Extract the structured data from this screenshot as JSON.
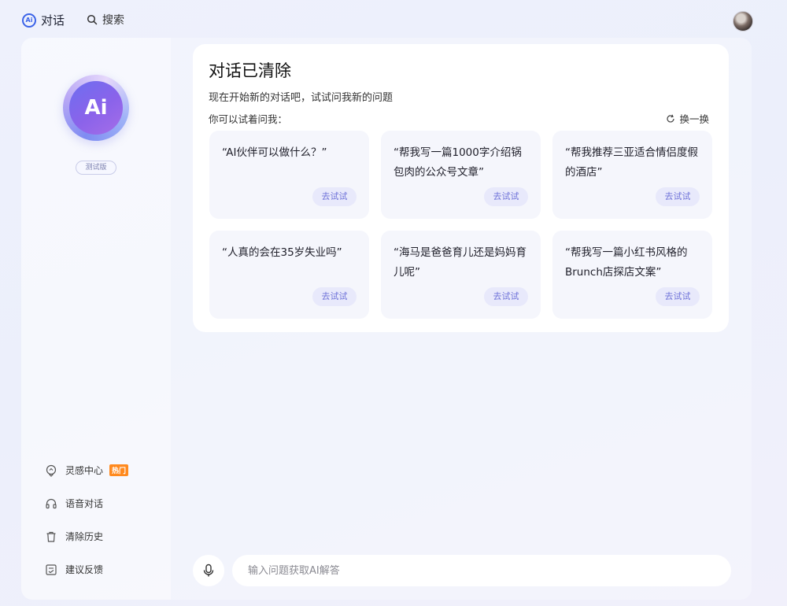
{
  "topbar": {
    "chat_label": "对话",
    "chat_icon_text": "Ai",
    "search_label": "搜索"
  },
  "sidebar": {
    "logo_text": "Ai",
    "beta_label": "测试版",
    "items": [
      {
        "label": "灵感中心",
        "icon": "lightbulb-icon",
        "badge": "热门"
      },
      {
        "label": "语音对话",
        "icon": "headset-icon"
      },
      {
        "label": "清除历史",
        "icon": "trash-icon"
      },
      {
        "label": "建议反馈",
        "icon": "feedback-icon"
      }
    ]
  },
  "main": {
    "title": "对话已清除",
    "subtitle": "现在开始新的对话吧，试试问我新的问题",
    "ask_hint": "你可以试着问我：",
    "refresh_label": "换一换",
    "try_label": "去试试",
    "suggestions": [
      {
        "text": "“AI伙伴可以做什么？”"
      },
      {
        "text": "“帮我写一篇1000字介绍锅包肉的公众号文章”"
      },
      {
        "text": "“帮我推荐三亚适合情侣度假的酒店”"
      },
      {
        "text": "“人真的会在35岁失业吗”"
      },
      {
        "text": "“海马是爸爸育儿还是妈妈育儿呢”"
      },
      {
        "text": "“帮我写一篇小红书风格的Brunch店探店文案”"
      }
    ]
  },
  "input": {
    "placeholder": "输入问题获取AI解答"
  },
  "colors": {
    "accent": "#6f73d9",
    "brand_blue": "#3b63e8",
    "hot_badge": "#ff8a1f"
  }
}
